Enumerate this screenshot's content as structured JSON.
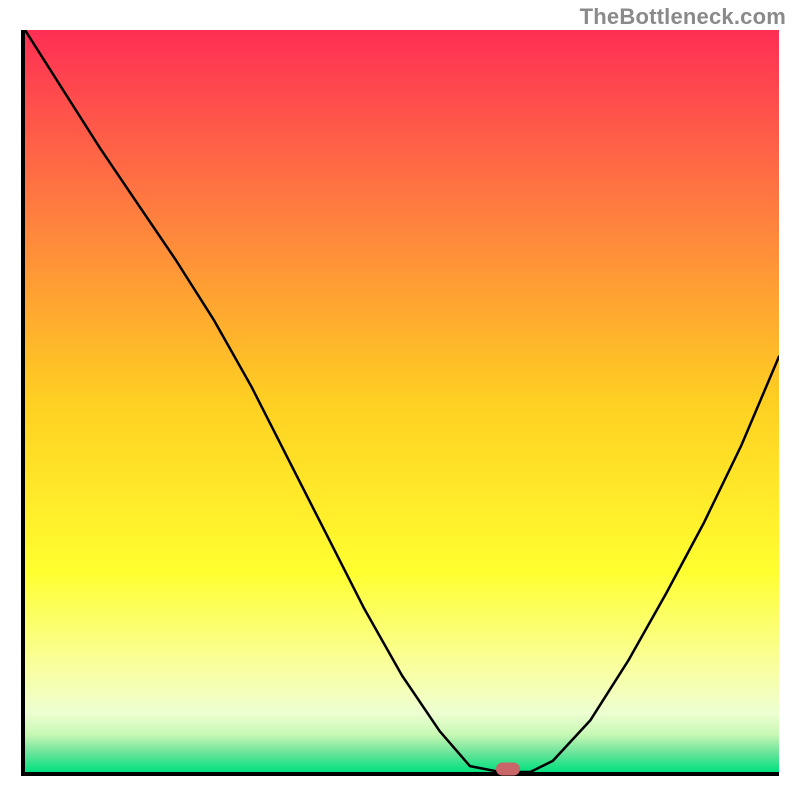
{
  "watermark": "TheBottleneck.com",
  "chart_data": {
    "type": "line",
    "title": "",
    "xlabel": "",
    "ylabel": "",
    "xlim": [
      0,
      100
    ],
    "ylim": [
      0,
      100
    ],
    "x": [
      0,
      5,
      10,
      15,
      20,
      25,
      30,
      35,
      40,
      45,
      50,
      55,
      59,
      63,
      67,
      70,
      75,
      80,
      85,
      90,
      95,
      100
    ],
    "y": [
      100,
      92,
      84,
      76.5,
      69,
      61,
      52,
      42,
      32,
      22,
      13,
      5.5,
      0.8,
      0,
      0,
      1.5,
      7,
      15,
      24,
      33.5,
      44,
      56
    ],
    "marker": {
      "x": 64,
      "y": 0,
      "shape": "pill",
      "color": "#c9666a"
    },
    "gradient_stops": [
      {
        "pos": 0.0,
        "color": "#ff2f55"
      },
      {
        "pos": 0.25,
        "color": "#ff803f"
      },
      {
        "pos": 0.5,
        "color": "#ffd022"
      },
      {
        "pos": 0.73,
        "color": "#ffff30"
      },
      {
        "pos": 0.86,
        "color": "#f9ffa0"
      },
      {
        "pos": 0.92,
        "color": "#eeffd2"
      },
      {
        "pos": 0.95,
        "color": "#c7f8b4"
      },
      {
        "pos": 0.975,
        "color": "#67e49a"
      },
      {
        "pos": 1.0,
        "color": "#00e27e"
      }
    ]
  }
}
